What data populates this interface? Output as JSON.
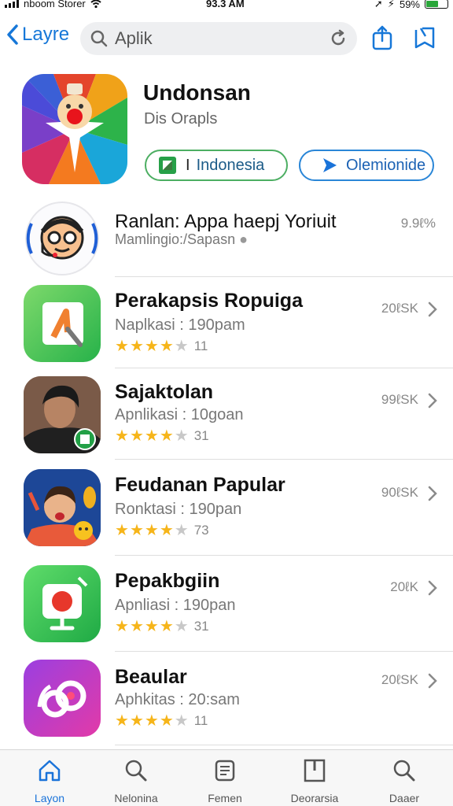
{
  "status_bar": {
    "carrier": "nboom Storer",
    "time": "93.3 AM",
    "battery": "59%",
    "battery_level": 0.59
  },
  "nav": {
    "back_label": "Layre",
    "search_value": "Aplik"
  },
  "featured": {
    "name": "Undonsan",
    "subtitle": "Dis Orapls",
    "primary_button": "Indonesia",
    "secondary_button": "Olemionide"
  },
  "apps": [
    {
      "title": "Ranlan: Appa haepj Yoriuit",
      "meta": "Mamlingio:/Sapasn",
      "size": "9.9ℓ%",
      "rating": null,
      "count": ""
    },
    {
      "title": "Perakapsis Ropuiga",
      "meta": "Naplkasi : 190pam",
      "size": "20ℓSK",
      "rating": 4,
      "count": "11"
    },
    {
      "title": "Sajaktolan",
      "meta": "Apnlikasi : 10goan",
      "size": "99ℓSK",
      "rating": 4,
      "count": "31"
    },
    {
      "title": "Feudanan Papular",
      "meta": "Ronktasi : 190pan",
      "size": "90ℓSK",
      "rating": 4,
      "count": "73"
    },
    {
      "title": "Pepakbgiin",
      "meta": "Apnliasi : 190pan",
      "size": "20ℓK",
      "rating": 4,
      "count": "31"
    },
    {
      "title": "Beaular",
      "meta": "Aphkitas : 20:sam",
      "size": "20ℓSK",
      "rating": 4,
      "count": "11"
    }
  ],
  "tabs": [
    {
      "label": "Layon",
      "icon": "home-icon",
      "active": true
    },
    {
      "label": "Nelonina",
      "icon": "search-icon",
      "active": false
    },
    {
      "label": "Femen",
      "icon": "document-icon",
      "active": false
    },
    {
      "label": "Deorarsia",
      "icon": "book-icon",
      "active": false
    },
    {
      "label": "Daaer",
      "icon": "search-icon",
      "active": false
    }
  ],
  "colors": {
    "accent": "#1a73d9",
    "star": "#f6b51a",
    "green": "#4cae62"
  }
}
